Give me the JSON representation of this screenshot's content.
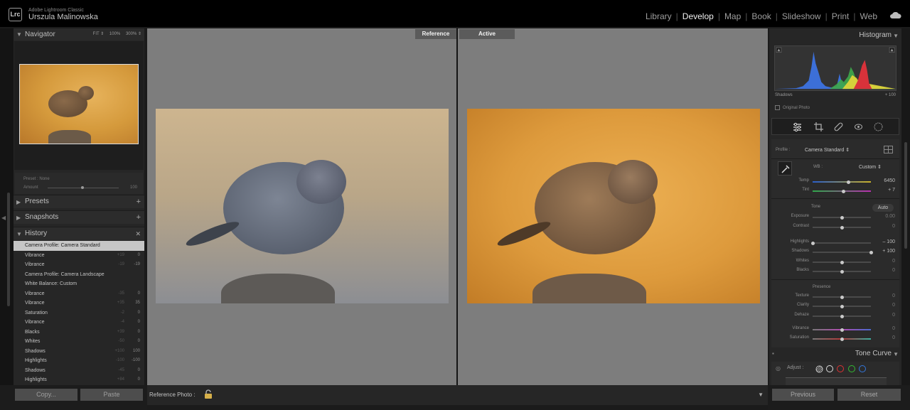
{
  "app": {
    "product": "Adobe Lightroom Classic",
    "logo": "Lrc",
    "user": "Urszula Malinowska"
  },
  "modules": [
    {
      "label": "Library",
      "active": false
    },
    {
      "label": "Develop",
      "active": true
    },
    {
      "label": "Map",
      "active": false
    },
    {
      "label": "Book",
      "active": false
    },
    {
      "label": "Slideshow",
      "active": false
    },
    {
      "label": "Print",
      "active": false
    },
    {
      "label": "Web",
      "active": false
    }
  ],
  "navigator": {
    "title": "Navigator",
    "zoom": [
      "FIT ⇕",
      "100%",
      "300% ⇕"
    ]
  },
  "preset": {
    "label": "Preset :",
    "value": "None",
    "amount_label": "Amount",
    "amount_value": "100",
    "amount_level": 0.5
  },
  "sections": {
    "presets": "Presets",
    "snapshots": "Snapshots",
    "history": "History"
  },
  "history": [
    {
      "label": "Camera Profile: Camera Standard",
      "a": "",
      "b": "",
      "selected": true
    },
    {
      "label": "Vibrance",
      "a": "+19",
      "b": "0"
    },
    {
      "label": "Vibrance",
      "a": "-19",
      "b": "-19"
    },
    {
      "label": "Camera Profile: Camera Landscape",
      "a": "",
      "b": ""
    },
    {
      "label": "White Balance: Custom",
      "a": "",
      "b": ""
    },
    {
      "label": "Vibrance",
      "a": "-35",
      "b": "0"
    },
    {
      "label": "Vibrance",
      "a": "+35",
      "b": "35"
    },
    {
      "label": "Saturation",
      "a": "-2",
      "b": "0"
    },
    {
      "label": "Vibrance",
      "a": "-4",
      "b": "0"
    },
    {
      "label": "Blacks",
      "a": "+39",
      "b": "0"
    },
    {
      "label": "Whites",
      "a": "-50",
      "b": "0"
    },
    {
      "label": "Shadows",
      "a": "+100",
      "b": "100"
    },
    {
      "label": "Highlights",
      "a": "-100",
      "b": "-100"
    },
    {
      "label": "Shadows",
      "a": "-45",
      "b": "0"
    },
    {
      "label": "Highlights",
      "a": "+84",
      "b": "0"
    }
  ],
  "compare": {
    "reference_label": "Reference",
    "active_label": "Active",
    "reference_photo_label": "Reference Photo :"
  },
  "buttons": {
    "copy": "Copy...",
    "paste": "Paste",
    "previous": "Previous",
    "reset": "Reset"
  },
  "histogram": {
    "title": "Histogram",
    "shadows_label": "Shadows",
    "shadows_value": "+ 100",
    "original_photo": "Original Photo"
  },
  "basic": {
    "profile_label": "Profile :",
    "profile_value": "Camera Standard ⇕",
    "wb_label": "WB :",
    "wb_value": "Custom ⇕",
    "temp": {
      "label": "Temp",
      "value": "6450",
      "level": 0.61
    },
    "tint": {
      "label": "Tint",
      "value": "+ 7",
      "level": 0.53
    },
    "tone_label": "Tone",
    "auto_label": "Auto",
    "exposure": {
      "label": "Exposure",
      "value": "0.00",
      "level": 0.5
    },
    "contrast": {
      "label": "Contrast",
      "value": "0",
      "level": 0.5
    },
    "highlights": {
      "label": "Highlights",
      "value": "– 100",
      "level": 0.0
    },
    "shadows": {
      "label": "Shadows",
      "value": "+ 100",
      "level": 1.0
    },
    "whites": {
      "label": "Whites",
      "value": "0",
      "level": 0.5
    },
    "blacks": {
      "label": "Blacks",
      "value": "0",
      "level": 0.5
    },
    "presence_label": "Presence",
    "texture": {
      "label": "Texture",
      "value": "0",
      "level": 0.5
    },
    "clarity": {
      "label": "Clarity",
      "value": "0",
      "level": 0.5
    },
    "dehaze": {
      "label": "Dehaze",
      "value": "0",
      "level": 0.5
    },
    "vibrance": {
      "label": "Vibrance",
      "value": "0",
      "level": 0.5
    },
    "saturation": {
      "label": "Saturation",
      "value": "0",
      "level": 0.5
    }
  },
  "tone_curve": {
    "title": "Tone Curve",
    "adjust_label": "Adjust :"
  }
}
